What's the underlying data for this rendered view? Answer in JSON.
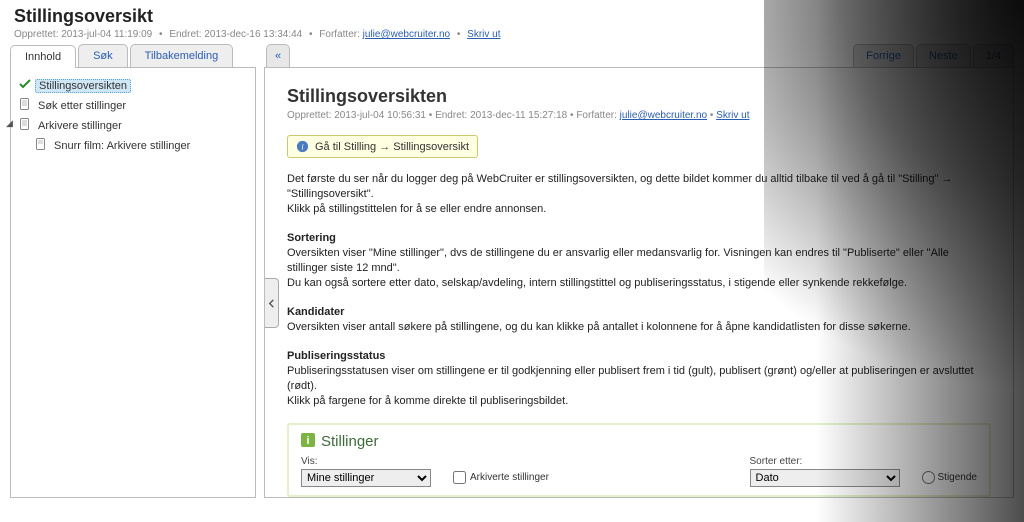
{
  "header": {
    "title": "Stillingsoversikt",
    "created_label": "Opprettet:",
    "created_value": "2013-jul-04 11:19:09",
    "modified_label": "Endret:",
    "modified_value": "2013-dec-16 13:34:44",
    "author_label": "Forfatter:",
    "author_link": "julie@webcruiter.no",
    "print_link": "Skriv ut"
  },
  "nav_tabs": {
    "content": "Innhold",
    "search": "Søk",
    "feedback": "Tilbakemelding"
  },
  "tree": {
    "item1": "Stillingsoversikten",
    "item2": "Søk etter stillinger",
    "item3": "Arkivere stillinger",
    "item3_child": "Snurr film: Arkivere stillinger"
  },
  "right_tabs": {
    "caret": "«",
    "prev": "Forrige",
    "next": "Neste",
    "page": "1/4"
  },
  "article": {
    "title": "Stillingsoversikten",
    "created_label": "Opprettet:",
    "created_value": "2013-jul-04 10:56:31",
    "modified_label": "Endret:",
    "modified_value": "2013-dec-11 15:27:18",
    "author_label": "Forfatter:",
    "author_link": "julie@webcruiter.no",
    "print_link": "Skriv ut",
    "callout": "Gå til Stilling → Stillingsoversikt",
    "p1": "Det første du ser når du logger deg på WebCruiter er stillingsoversikten, og dette bildet kommer du alltid tilbake til ved å gå til \"Stilling\" → \"Stillingsoversikt\".\nKlikk på stillingstittelen for å se eller endre annonsen.",
    "h2": "Sortering",
    "p2": "Oversikten viser \"Mine stillinger\", dvs de stillingene du er ansvarlig eller medansvarlig for. Visningen kan endres til \"Publiserte\" eller \"Alle stillinger siste 12 mnd\".\nDu kan også sortere etter dato, selskap/avdeling, intern stillingstittel og publiseringsstatus, i stigende eller synkende rekkefølge.",
    "h3": "Kandidater",
    "p3": "Oversikten viser antall søkere på stillingene, og du kan klikke på antallet i kolonnene for å åpne kandidatlisten for disse søkerne.",
    "h4": "Publiseringsstatus",
    "p4": "Publiseringsstatusen viser om stillingene er til godkjenning eller publisert frem i tid (gult), publisert (grønt) og/eller at publiseringen er avsluttet (rødt).\nKlikk på fargene for å komme direkte til publiseringsbildet."
  },
  "inner": {
    "title": "Stillinger",
    "show_label": "Vis:",
    "show_value": "Mine stillinger",
    "archived_label": "Arkiverte stillinger",
    "sort_label": "Sorter etter:",
    "sort_value": "Dato",
    "asc_label": "Stigende"
  }
}
